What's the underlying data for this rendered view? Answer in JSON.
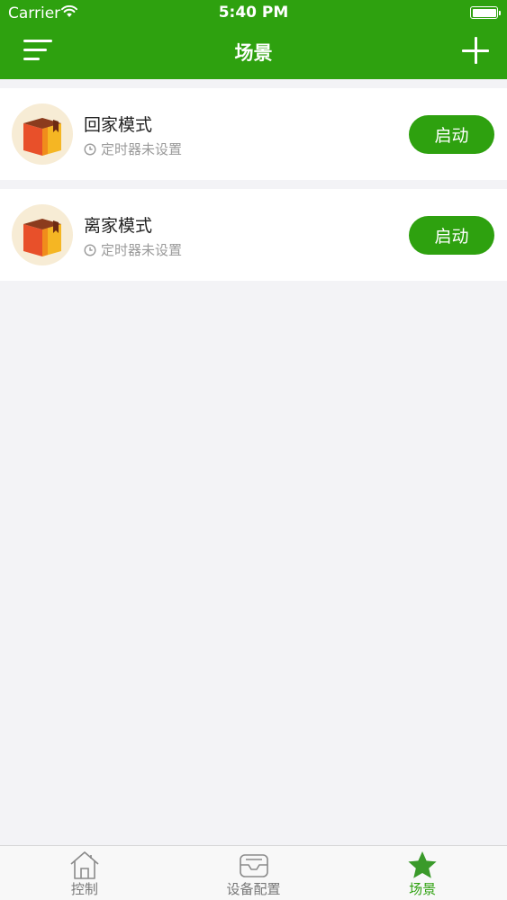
{
  "status_bar": {
    "carrier": "Carrier",
    "time": "5:40 PM"
  },
  "nav": {
    "title": "场景",
    "menu_icon": "menu-icon",
    "add_icon": "plus-icon"
  },
  "scenes": [
    {
      "name": "回家模式",
      "timer_text": "定时器未设置",
      "button_label": "启动"
    },
    {
      "name": "离家模式",
      "timer_text": "定时器未设置",
      "button_label": "启动"
    }
  ],
  "tabs": [
    {
      "label": "控制",
      "icon": "house-icon",
      "active": false
    },
    {
      "label": "设备配置",
      "icon": "tray-icon",
      "active": false
    },
    {
      "label": "场景",
      "icon": "star-icon",
      "active": true
    }
  ],
  "colors": {
    "accent": "#2ea10f",
    "background": "#f3f3f6",
    "muted_text": "#9a9a9a"
  }
}
